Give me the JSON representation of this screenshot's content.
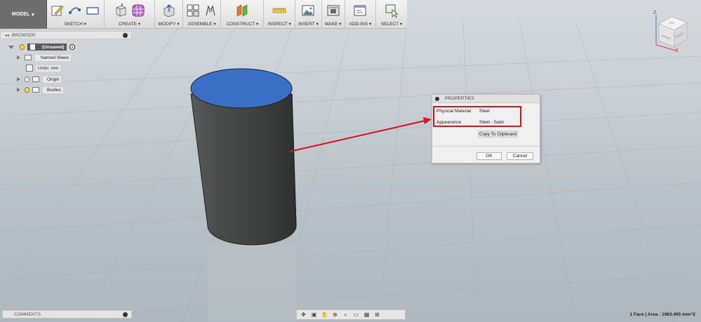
{
  "toolbar": {
    "model_label": "MODEL",
    "groups": [
      {
        "label": "SKETCH"
      },
      {
        "label": "CREATE"
      },
      {
        "label": "MODIFY"
      },
      {
        "label": "ASSEMBLE"
      },
      {
        "label": "CONSTRUCT"
      },
      {
        "label": "INSPECT"
      },
      {
        "label": "INSERT"
      },
      {
        "label": "MAKE"
      },
      {
        "label": "ADD-INS"
      },
      {
        "label": "SELECT"
      }
    ]
  },
  "browser": {
    "title": "BROWSER",
    "root": "(Unsaved)",
    "items": [
      {
        "label": "Named Views"
      },
      {
        "label": "Units: mm"
      },
      {
        "label": "Origin"
      },
      {
        "label": "Bodies"
      }
    ]
  },
  "properties": {
    "title": "PROPERTIES",
    "rows": [
      {
        "label": "Physical Material",
        "value": "Steel"
      },
      {
        "label": "Appearance",
        "value": "Steel - Satin"
      }
    ],
    "copy_label": "Copy To Clipboard",
    "ok_label": "OK",
    "cancel_label": "Cancel"
  },
  "viewcube": {
    "top": "TOP",
    "front": "FRONT",
    "right": "RIGHT",
    "axis_z": "Z",
    "axis_x": "X"
  },
  "comments": {
    "label": "COMMENTS"
  },
  "status": {
    "text": "1 Face | Area : 1963.495 mm^2"
  },
  "colors": {
    "top_face": "#3a6fc6",
    "body": "#4a4c4c",
    "annotation": "#d9141b",
    "model_button": "#6e6e6e"
  }
}
